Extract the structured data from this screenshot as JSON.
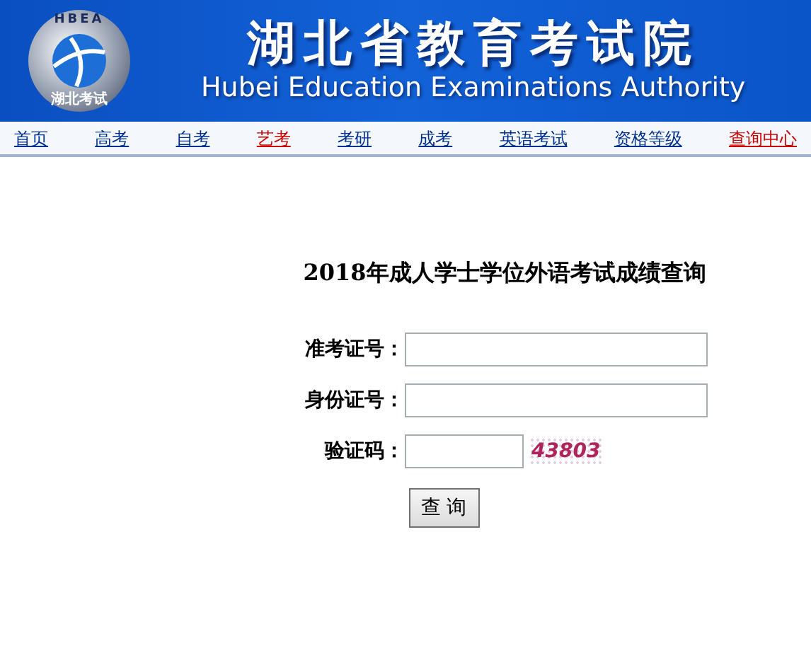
{
  "header": {
    "logo_top": "HBEA",
    "logo_bottom": "湖北考试",
    "title": "湖北省教育考试院",
    "subtitle": "Hubei Education Examinations Authority"
  },
  "nav": [
    {
      "label": "首页",
      "color": "#00308f"
    },
    {
      "label": "高考",
      "color": "#00308f"
    },
    {
      "label": "自考",
      "color": "#00308f"
    },
    {
      "label": "艺考",
      "color": "#cc0000"
    },
    {
      "label": "考研",
      "color": "#00308f"
    },
    {
      "label": "成考",
      "color": "#00308f"
    },
    {
      "label": "英语考试",
      "color": "#00308f"
    },
    {
      "label": "资格等级",
      "color": "#00308f"
    },
    {
      "label": "查询中心",
      "color": "#cc0000"
    }
  ],
  "form": {
    "title": "2018年成人学士学位外语考试成绩查询",
    "fields": [
      {
        "label": "准考证号：",
        "kind": "text"
      },
      {
        "label": "身份证号：",
        "kind": "text"
      },
      {
        "label": "验证码：",
        "kind": "captcha",
        "captcha": "43803"
      }
    ],
    "button": "查 询"
  }
}
